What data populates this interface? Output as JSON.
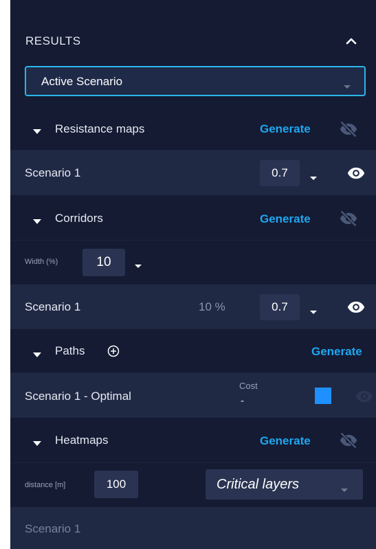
{
  "results": {
    "title": "RESULTS",
    "active_scenario": "Active Scenario"
  },
  "resistance": {
    "title": "Resistance maps",
    "generate": "Generate",
    "row": {
      "name": "Scenario 1",
      "opacity": "0.7"
    }
  },
  "corridors": {
    "title": "Corridors",
    "generate": "Generate",
    "width_label": "Width (%)",
    "width_value": "10",
    "row": {
      "name": "Scenario 1",
      "percent": "10 %",
      "opacity": "0.7"
    }
  },
  "paths": {
    "title": "Paths",
    "generate": "Generate",
    "row": {
      "name": "Scenario 1 - Optimal",
      "cost_label": "Cost",
      "cost_value": "-",
      "color": "#1e90ff"
    }
  },
  "heatmaps": {
    "title": "Heatmaps",
    "generate": "Generate",
    "distance_label": "distance [m]",
    "distance_value": "100",
    "layers_select": "Critical layers",
    "row": {
      "name": "Scenario 1"
    }
  }
}
